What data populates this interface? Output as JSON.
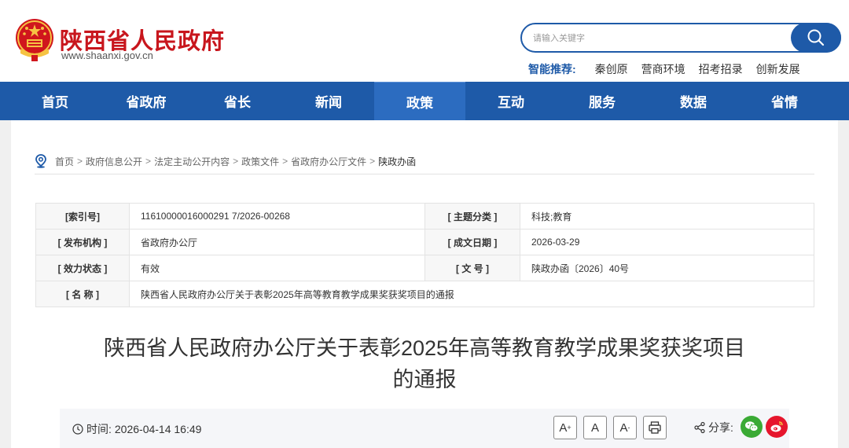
{
  "header": {
    "site_name": "陕西省人民政府",
    "site_url": "www.shaanxi.gov.cn",
    "search": {
      "placeholder": "请输入关键字"
    },
    "smart_rec": {
      "label": "智能推荐:",
      "links": [
        "秦创原",
        "营商环境",
        "招考招录",
        "创新发展"
      ]
    }
  },
  "nav": {
    "items": [
      "首页",
      "省政府",
      "省长",
      "新闻",
      "政策",
      "互动",
      "服务",
      "数据",
      "省情"
    ],
    "active": "政策"
  },
  "breadcrumb": {
    "items": [
      "首页",
      "政府信息公开",
      "法定主动公开内容",
      "政策文件",
      "省政府办公厅文件",
      "陕政办函"
    ],
    "sep": ">"
  },
  "info": {
    "index_label": "[索引号]",
    "index_value": "11610000016000291 7/2026-00268",
    "topic_label": "[ 主题分类 ]",
    "topic_value": "科技;教育",
    "issuer_label": "[ 发布机构 ]",
    "issuer_value": "省政府办公厅",
    "date_label": "[ 成文日期 ]",
    "date_value": "2026-03-29",
    "status_label": "[ 效力状态 ]",
    "status_value": "有效",
    "docno_label": "[ 文 号 ]",
    "docno_value": "陕政办函〔2026〕40号",
    "name_label": "[ 名 称 ]",
    "name_value": "陕西省人民政府办公厅关于表彰2025年高等教育教学成果奖获奖项目的通报"
  },
  "doc": {
    "title_line1": "陕西省人民政府办公厅关于表彰2025年高等教育教学成果奖获奖项目",
    "title_line2": "的通报"
  },
  "meta": {
    "time_label": "时间:",
    "time_value": "2026-04-14 16:49",
    "font_large": "A",
    "font_large_sup": "+",
    "font_normal": "A",
    "font_small": "A",
    "font_small_sup": "-",
    "share_label": "分享:"
  },
  "colors": {
    "brand_red": "#c8161d",
    "nav_blue": "#1e5aa8",
    "wechat_green": "#3aaa35",
    "weibo_red": "#e6162d"
  }
}
